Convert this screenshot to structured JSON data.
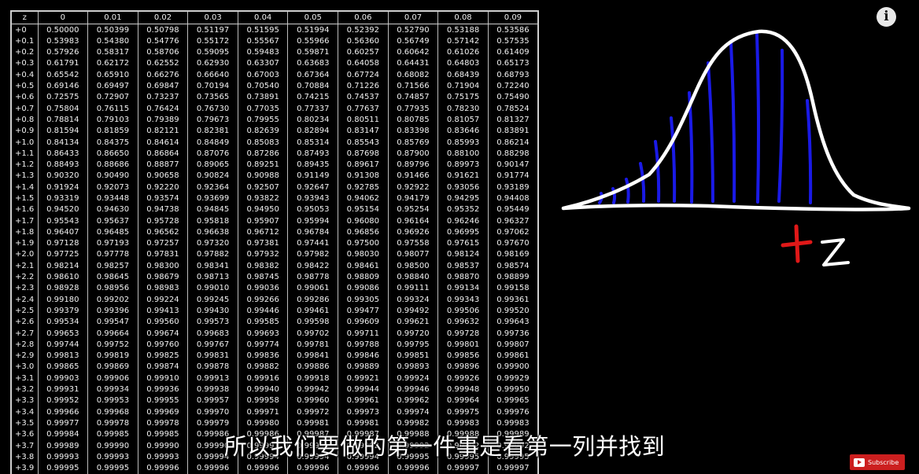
{
  "table": {
    "headers": [
      "z",
      "0",
      "0.01",
      "0.02",
      "0.03",
      "0.04",
      "0.05",
      "0.06",
      "0.07",
      "0.08",
      "0.09"
    ],
    "rows": [
      [
        "+0",
        "0.50000",
        "0.50399",
        "0.50798",
        "0.51197",
        "0.51595",
        "0.51994",
        "0.52392",
        "0.52790",
        "0.53188",
        "0.53586"
      ],
      [
        "+0.1",
        "0.53983",
        "0.54380",
        "0.54776",
        "0.55172",
        "0.55567",
        "0.55966",
        "0.56360",
        "0.56749",
        "0.57142",
        "0.57535"
      ],
      [
        "+0.2",
        "0.57926",
        "0.58317",
        "0.58706",
        "0.59095",
        "0.59483",
        "0.59871",
        "0.60257",
        "0.60642",
        "0.61026",
        "0.61409"
      ],
      [
        "+0.3",
        "0.61791",
        "0.62172",
        "0.62552",
        "0.62930",
        "0.63307",
        "0.63683",
        "0.64058",
        "0.64431",
        "0.64803",
        "0.65173"
      ],
      [
        "+0.4",
        "0.65542",
        "0.65910",
        "0.66276",
        "0.66640",
        "0.67003",
        "0.67364",
        "0.67724",
        "0.68082",
        "0.68439",
        "0.68793"
      ],
      [
        "+0.5",
        "0.69146",
        "0.69497",
        "0.69847",
        "0.70194",
        "0.70540",
        "0.70884",
        "0.71226",
        "0.71566",
        "0.71904",
        "0.72240"
      ],
      [
        "+0.6",
        "0.72575",
        "0.72907",
        "0.73237",
        "0.73565",
        "0.73891",
        "0.74215",
        "0.74537",
        "0.74857",
        "0.75175",
        "0.75490"
      ],
      [
        "+0.7",
        "0.75804",
        "0.76115",
        "0.76424",
        "0.76730",
        "0.77035",
        "0.77337",
        "0.77637",
        "0.77935",
        "0.78230",
        "0.78524"
      ],
      [
        "+0.8",
        "0.78814",
        "0.79103",
        "0.79389",
        "0.79673",
        "0.79955",
        "0.80234",
        "0.80511",
        "0.80785",
        "0.81057",
        "0.81327"
      ],
      [
        "+0.9",
        "0.81594",
        "0.81859",
        "0.82121",
        "0.82381",
        "0.82639",
        "0.82894",
        "0.83147",
        "0.83398",
        "0.83646",
        "0.83891"
      ],
      [
        "+1.0",
        "0.84134",
        "0.84375",
        "0.84614",
        "0.84849",
        "0.85083",
        "0.85314",
        "0.85543",
        "0.85769",
        "0.85993",
        "0.86214"
      ],
      [
        "+1.1",
        "0.86433",
        "0.86650",
        "0.86864",
        "0.87076",
        "0.87286",
        "0.87493",
        "0.87698",
        "0.87900",
        "0.88100",
        "0.88298"
      ],
      [
        "+1.2",
        "0.88493",
        "0.88686",
        "0.88877",
        "0.89065",
        "0.89251",
        "0.89435",
        "0.89617",
        "0.89796",
        "0.89973",
        "0.90147"
      ],
      [
        "+1.3",
        "0.90320",
        "0.90490",
        "0.90658",
        "0.90824",
        "0.90988",
        "0.91149",
        "0.91308",
        "0.91466",
        "0.91621",
        "0.91774"
      ],
      [
        "+1.4",
        "0.91924",
        "0.92073",
        "0.92220",
        "0.92364",
        "0.92507",
        "0.92647",
        "0.92785",
        "0.92922",
        "0.93056",
        "0.93189"
      ],
      [
        "+1.5",
        "0.93319",
        "0.93448",
        "0.93574",
        "0.93699",
        "0.93822",
        "0.93943",
        "0.94062",
        "0.94179",
        "0.94295",
        "0.94408"
      ],
      [
        "+1.6",
        "0.94520",
        "0.94630",
        "0.94738",
        "0.94845",
        "0.94950",
        "0.95053",
        "0.95154",
        "0.95254",
        "0.95352",
        "0.95449"
      ],
      [
        "+1.7",
        "0.95543",
        "0.95637",
        "0.95728",
        "0.95818",
        "0.95907",
        "0.95994",
        "0.96080",
        "0.96164",
        "0.96246",
        "0.96327"
      ],
      [
        "+1.8",
        "0.96407",
        "0.96485",
        "0.96562",
        "0.96638",
        "0.96712",
        "0.96784",
        "0.96856",
        "0.96926",
        "0.96995",
        "0.97062"
      ],
      [
        "+1.9",
        "0.97128",
        "0.97193",
        "0.97257",
        "0.97320",
        "0.97381",
        "0.97441",
        "0.97500",
        "0.97558",
        "0.97615",
        "0.97670"
      ],
      [
        "+2.0",
        "0.97725",
        "0.97778",
        "0.97831",
        "0.97882",
        "0.97932",
        "0.97982",
        "0.98030",
        "0.98077",
        "0.98124",
        "0.98169"
      ],
      [
        "+2.1",
        "0.98214",
        "0.98257",
        "0.98300",
        "0.98341",
        "0.98382",
        "0.98422",
        "0.98461",
        "0.98500",
        "0.98537",
        "0.98574"
      ],
      [
        "+2.2",
        "0.98610",
        "0.98645",
        "0.98679",
        "0.98713",
        "0.98745",
        "0.98778",
        "0.98809",
        "0.98840",
        "0.98870",
        "0.98899"
      ],
      [
        "+2.3",
        "0.98928",
        "0.98956",
        "0.98983",
        "0.99010",
        "0.99036",
        "0.99061",
        "0.99086",
        "0.99111",
        "0.99134",
        "0.99158"
      ],
      [
        "+2.4",
        "0.99180",
        "0.99202",
        "0.99224",
        "0.99245",
        "0.99266",
        "0.99286",
        "0.99305",
        "0.99324",
        "0.99343",
        "0.99361"
      ],
      [
        "+2.5",
        "0.99379",
        "0.99396",
        "0.99413",
        "0.99430",
        "0.99446",
        "0.99461",
        "0.99477",
        "0.99492",
        "0.99506",
        "0.99520"
      ],
      [
        "+2.6",
        "0.99534",
        "0.99547",
        "0.99560",
        "0.99573",
        "0.99585",
        "0.99598",
        "0.99609",
        "0.99621",
        "0.99632",
        "0.99643"
      ],
      [
        "+2.7",
        "0.99653",
        "0.99664",
        "0.99674",
        "0.99683",
        "0.99693",
        "0.99702",
        "0.99711",
        "0.99720",
        "0.99728",
        "0.99736"
      ],
      [
        "+2.8",
        "0.99744",
        "0.99752",
        "0.99760",
        "0.99767",
        "0.99774",
        "0.99781",
        "0.99788",
        "0.99795",
        "0.99801",
        "0.99807"
      ],
      [
        "+2.9",
        "0.99813",
        "0.99819",
        "0.99825",
        "0.99831",
        "0.99836",
        "0.99841",
        "0.99846",
        "0.99851",
        "0.99856",
        "0.99861"
      ],
      [
        "+3.0",
        "0.99865",
        "0.99869",
        "0.99874",
        "0.99878",
        "0.99882",
        "0.99886",
        "0.99889",
        "0.99893",
        "0.99896",
        "0.99900"
      ],
      [
        "+3.1",
        "0.99903",
        "0.99906",
        "0.99910",
        "0.99913",
        "0.99916",
        "0.99918",
        "0.99921",
        "0.99924",
        "0.99926",
        "0.99929"
      ],
      [
        "+3.2",
        "0.99931",
        "0.99934",
        "0.99936",
        "0.99938",
        "0.99940",
        "0.99942",
        "0.99944",
        "0.99946",
        "0.99948",
        "0.99950"
      ],
      [
        "+3.3",
        "0.99952",
        "0.99953",
        "0.99955",
        "0.99957",
        "0.99958",
        "0.99960",
        "0.99961",
        "0.99962",
        "0.99964",
        "0.99965"
      ],
      [
        "+3.4",
        "0.99966",
        "0.99968",
        "0.99969",
        "0.99970",
        "0.99971",
        "0.99972",
        "0.99973",
        "0.99974",
        "0.99975",
        "0.99976"
      ],
      [
        "+3.5",
        "0.99977",
        "0.99978",
        "0.99978",
        "0.99979",
        "0.99980",
        "0.99981",
        "0.99981",
        "0.99982",
        "0.99983",
        "0.99983"
      ],
      [
        "+3.6",
        "0.99984",
        "0.99985",
        "0.99985",
        "0.99986",
        "0.99986",
        "0.99987",
        "0.99987",
        "0.99988",
        "0.99988",
        "0.99989"
      ],
      [
        "+3.7",
        "0.99989",
        "0.99990",
        "0.99990",
        "0.99990",
        "0.99991",
        "0.99991",
        "0.99992",
        "0.99992",
        "0.99992",
        "0.99992"
      ],
      [
        "+3.8",
        "0.99993",
        "0.99993",
        "0.99993",
        "0.99994",
        "0.99994",
        "0.99994",
        "0.99994",
        "0.99995",
        "0.99995",
        "0.99995"
      ],
      [
        "+3.9",
        "0.99995",
        "0.99995",
        "0.99996",
        "0.99996",
        "0.99996",
        "0.99996",
        "0.99996",
        "0.99996",
        "0.99997",
        "0.99997"
      ]
    ]
  },
  "drawing": {
    "annotation_sign": "+",
    "annotation_letter": "Z",
    "colors": {
      "curve": "#ffffff",
      "shading": "#1a1ae6",
      "plus": "#e01818"
    }
  },
  "player": {
    "info_icon": "info-icon",
    "info_glyph": "i",
    "subscribe_label": "Subscribe",
    "subscribe_icon": "play-icon"
  },
  "subtitle": "所以我们要做的第一件事是看第一列并找到"
}
